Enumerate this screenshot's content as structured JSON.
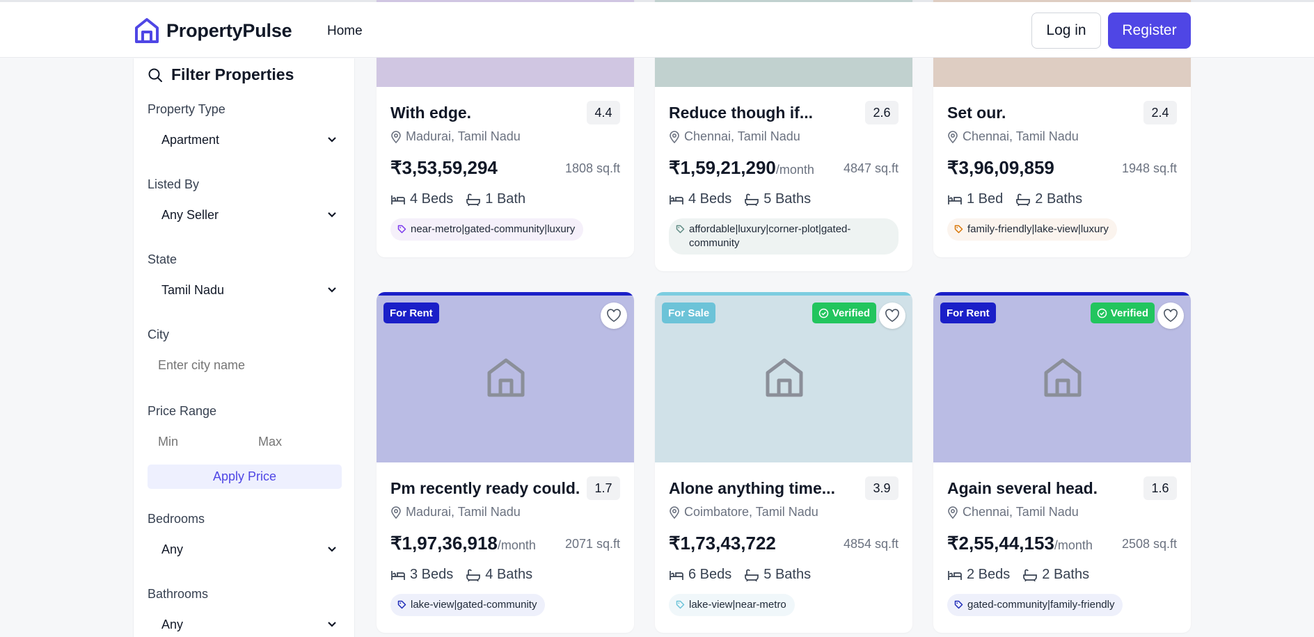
{
  "header": {
    "brand": "PropertyPulse",
    "nav_home": "Home",
    "login": "Log in",
    "register": "Register"
  },
  "sidebar": {
    "title": "Filter Properties",
    "property_type": {
      "label": "Property Type",
      "value": "Apartment"
    },
    "listed_by": {
      "label": "Listed By",
      "value": "Any Seller"
    },
    "state": {
      "label": "State",
      "value": "Tamil Nadu"
    },
    "city": {
      "label": "City",
      "placeholder": "Enter city name"
    },
    "price_range": {
      "label": "Price Range",
      "min_placeholder": "Min",
      "max_placeholder": "Max",
      "apply": "Apply Price"
    },
    "bedrooms": {
      "label": "Bedrooms",
      "value": "Any"
    },
    "bathrooms": {
      "label": "Bathrooms",
      "value": "Any"
    }
  },
  "cards": [
    {
      "title": "With edge.",
      "rating": "4.4",
      "location": "Madurai, Tamil Nadu",
      "price": "₹3,53,59,294",
      "per": "",
      "sqft": "1808 sq.ft",
      "beds": "4 Beds",
      "baths": "1 Bath",
      "tags_line1": "near-metro|gated-community|luxury",
      "tags_line2": "",
      "image_color": "#d0c6e2",
      "tag_bg": "#f5f0fa",
      "tag_icon_color": "#7c3aed"
    },
    {
      "title": "Reduce though if...",
      "rating": "2.6",
      "location": "Chennai, Tamil Nadu",
      "price": "₹1,59,21,290",
      "per": "/month",
      "sqft": "4847 sq.ft",
      "beds": "4 Beds",
      "baths": "5 Baths",
      "tags_line1": "affordable|luxury|corner-plot|gated-",
      "tags_line2": "community",
      "image_color": "#c1d1cf",
      "tag_bg": "#eef3f2",
      "tag_icon_color": "#5f8b84"
    },
    {
      "title": "Set our.",
      "rating": "2.4",
      "location": "Chennai, Tamil Nadu",
      "price": "₹3,96,09,859",
      "per": "",
      "sqft": "1948 sq.ft",
      "beds": "1 Bed",
      "baths": "2 Baths",
      "tags_line1": "family-friendly|lake-view|luxury",
      "tags_line2": "",
      "image_color": "#decdc2",
      "tag_bg": "#fbf4ee",
      "tag_icon_color": "#d97706"
    },
    {
      "title": "Pm recently ready could.",
      "rating": "1.7",
      "location": "Madurai, Tamil Nadu",
      "price": "₹1,97,36,918",
      "per": "/month",
      "sqft": "2071 sq.ft",
      "beds": "3 Beds",
      "baths": "4 Baths",
      "tags_line1": "lake-view|gated-community",
      "tags_line2": "",
      "image_color": "#babce4",
      "tag_bg": "#eef0fb",
      "tag_icon_color": "#1e2bb8",
      "status": "For Rent",
      "status_color": "#1a1fc8",
      "verified": "",
      "bar_color": "#1a1fc8"
    },
    {
      "title": "Alone anything time...",
      "rating": "3.9",
      "location": "Coimbatore, Tamil Nadu",
      "price": "₹1,73,43,722",
      "per": "",
      "sqft": "4854 sq.ft",
      "beds": "6 Beds",
      "baths": "5 Baths",
      "tags_line1": "lake-view|near-metro",
      "tags_line2": "",
      "image_color": "#d0e1e8",
      "tag_bg": "#f0f7fa",
      "tag_icon_color": "#6cc3d8",
      "status": "For Sale",
      "status_color": "#6cc3d8",
      "verified": "Verified",
      "bar_color": "#7ccde0"
    },
    {
      "title": "Again several head.",
      "rating": "1.6",
      "location": "Chennai, Tamil Nadu",
      "price": "₹2,55,44,153",
      "per": "/month",
      "sqft": "2508 sq.ft",
      "beds": "2 Beds",
      "baths": "2 Baths",
      "tags_line1": "gated-community|family-friendly",
      "tags_line2": "",
      "image_color": "#babce4",
      "tag_bg": "#eef0fb",
      "tag_icon_color": "#1e2bb8",
      "status": "For Rent",
      "status_color": "#1a1fc8",
      "verified": "Verified",
      "bar_color": "#1a1fc8"
    }
  ],
  "colors": {
    "accent": "#4f46e5",
    "verified_green": "#22c55e"
  }
}
